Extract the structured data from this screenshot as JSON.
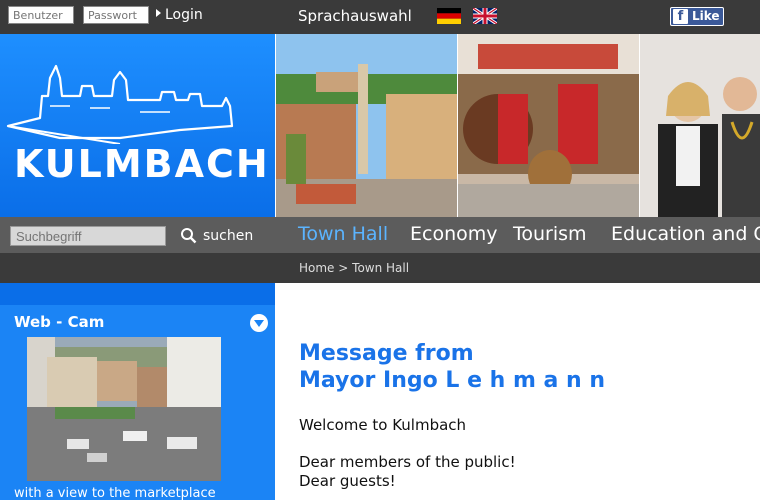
{
  "topbar": {
    "username_placeholder": "Benutzer",
    "password_placeholder": "Passwort",
    "login_label": "Login",
    "language_label": "Sprachauswahl",
    "flags": [
      "german-flag-icon",
      "uk-flag-icon"
    ],
    "facebook_label": "Like"
  },
  "header": {
    "logo_text": "KULMBACH",
    "photos": [
      "town-square-photo",
      "barrel-tapping-photo",
      "mayor-photo"
    ]
  },
  "nav": {
    "search_placeholder": "Suchbegriff",
    "search_label": "suchen",
    "items": [
      "Town Hall",
      "Economy",
      "Tourism",
      "Education and Cu"
    ],
    "active_index": 0
  },
  "breadcrumb": {
    "home": "Home",
    "separator": ">",
    "current": "Town Hall"
  },
  "sidebar": {
    "webcam_title": "Web - Cam",
    "webcam_caption": "with a view to the marketplace"
  },
  "main": {
    "title_line1": "Message from",
    "title_line2": "Mayor Ingo L e h m a n n",
    "welcome": "Welcome to Kulmbach",
    "dear_public": "Dear members of the public!",
    "dear_guests": "Dear guests!"
  },
  "colors": {
    "accent_blue": "#1a73e8",
    "sidebar_blue": "#1b84f5",
    "topbar": "#3a3a3a",
    "navbar": "#5c5c5c",
    "active_nav": "#5bb4ff",
    "facebook": "#3b5998"
  }
}
